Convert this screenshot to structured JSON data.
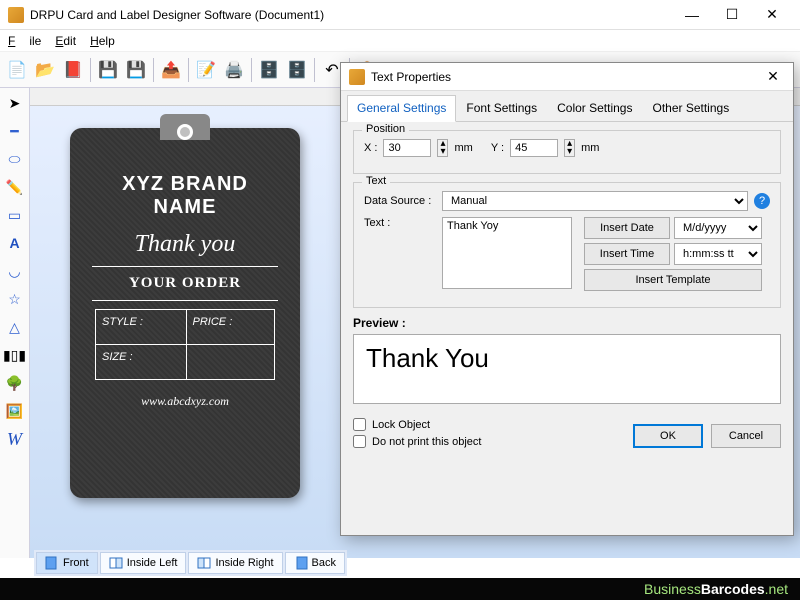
{
  "titlebar": {
    "title": "DRPU Card and Label Designer Software (Document1)"
  },
  "menu": {
    "file": "File",
    "edit": "Edit",
    "help": "Help"
  },
  "page_tabs": {
    "front": "Front",
    "inside_left": "Inside Left",
    "inside_right": "Inside Right",
    "back": "Back"
  },
  "footer": {
    "brand1": "Business",
    "brand2": "Barcodes",
    "tld": ".net"
  },
  "card": {
    "brand_line1": "XYZ BRAND",
    "brand_line2": "NAME",
    "thank": "Thank you",
    "order": "YOUR ORDER",
    "style": "STYLE :",
    "price": "PRICE :",
    "size": "SIZE :",
    "url": "www.abcdxyz.com"
  },
  "dialog": {
    "title": "Text Properties",
    "tabs": {
      "general": "General Settings",
      "font": "Font Settings",
      "color": "Color Settings",
      "other": "Other Settings"
    },
    "position": {
      "legend": "Position",
      "x_label": "X :",
      "x_value": "30",
      "y_label": "Y :",
      "y_value": "45",
      "unit": "mm"
    },
    "text_section": {
      "legend": "Text",
      "datasource_label": "Data Source :",
      "datasource_value": "Manual",
      "text_label": "Text :",
      "text_value": "Thank Yoy",
      "insert_date": "Insert Date",
      "date_format": "M/d/yyyy",
      "insert_time": "Insert Time",
      "time_format": "h:mm:ss tt",
      "insert_template": "Insert Template"
    },
    "preview_label": "Preview :",
    "preview_text": "Thank You",
    "lock": "Lock Object",
    "noprint": "Do not print this object",
    "ok": "OK",
    "cancel": "Cancel"
  }
}
